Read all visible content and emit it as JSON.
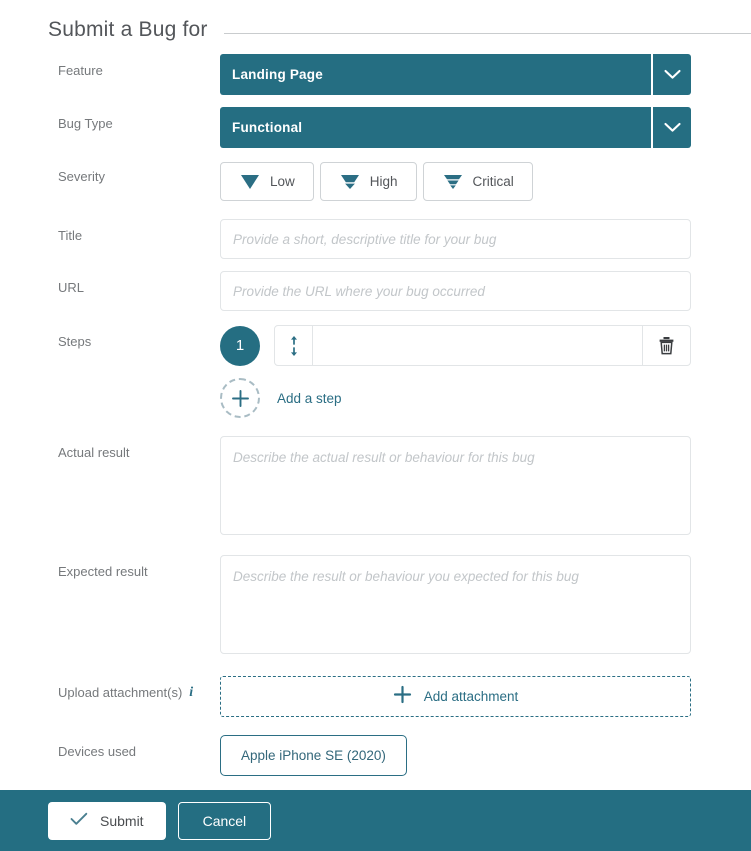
{
  "header": {
    "title": "Submit a Bug for"
  },
  "colors": {
    "accent_teal": "#256e82",
    "footer_teal": "#246e82",
    "label_gray": "#76797c",
    "placeholder_gray": "#c2c6c9",
    "border_gray": "#e2e5e7"
  },
  "form": {
    "feature": {
      "label": "Feature",
      "value": "Landing Page"
    },
    "bug_type": {
      "label": "Bug Type",
      "value": "Functional"
    },
    "severity": {
      "label": "Severity",
      "options": [
        {
          "label": "Low",
          "icon": "severity-low-icon",
          "bars": 1
        },
        {
          "label": "High",
          "icon": "severity-high-icon",
          "bars": 2
        },
        {
          "label": "Critical",
          "icon": "severity-critical-icon",
          "bars": 3
        }
      ]
    },
    "title": {
      "label": "Title",
      "value": "",
      "placeholder": "Provide a short, descriptive title for your bug"
    },
    "url": {
      "label": "URL",
      "value": "",
      "placeholder": "Provide the URL where your bug occurred"
    },
    "steps": {
      "label": "Steps",
      "items": [
        {
          "number": "1",
          "value": "",
          "placeholder": ""
        }
      ],
      "add_label": "Add a step",
      "delete_icon": "trash-icon",
      "reorder_icon": "reorder-arrows-icon",
      "add_icon": "plus-icon"
    },
    "actual_result": {
      "label": "Actual result",
      "value": "",
      "placeholder": "Describe the actual result or behaviour for this bug"
    },
    "expected_result": {
      "label": "Expected result",
      "value": "",
      "placeholder": "Describe the result or behaviour you expected for this bug"
    },
    "attachments": {
      "label": "Upload attachment(s)",
      "info_icon": "info-icon",
      "add_label": "Add attachment",
      "add_icon": "plus-icon"
    },
    "devices": {
      "label": "Devices used",
      "items": [
        {
          "name": "Apple iPhone SE (2020)"
        }
      ]
    }
  },
  "footer": {
    "submit_label": "Submit",
    "submit_icon": "check-icon",
    "cancel_label": "Cancel"
  }
}
